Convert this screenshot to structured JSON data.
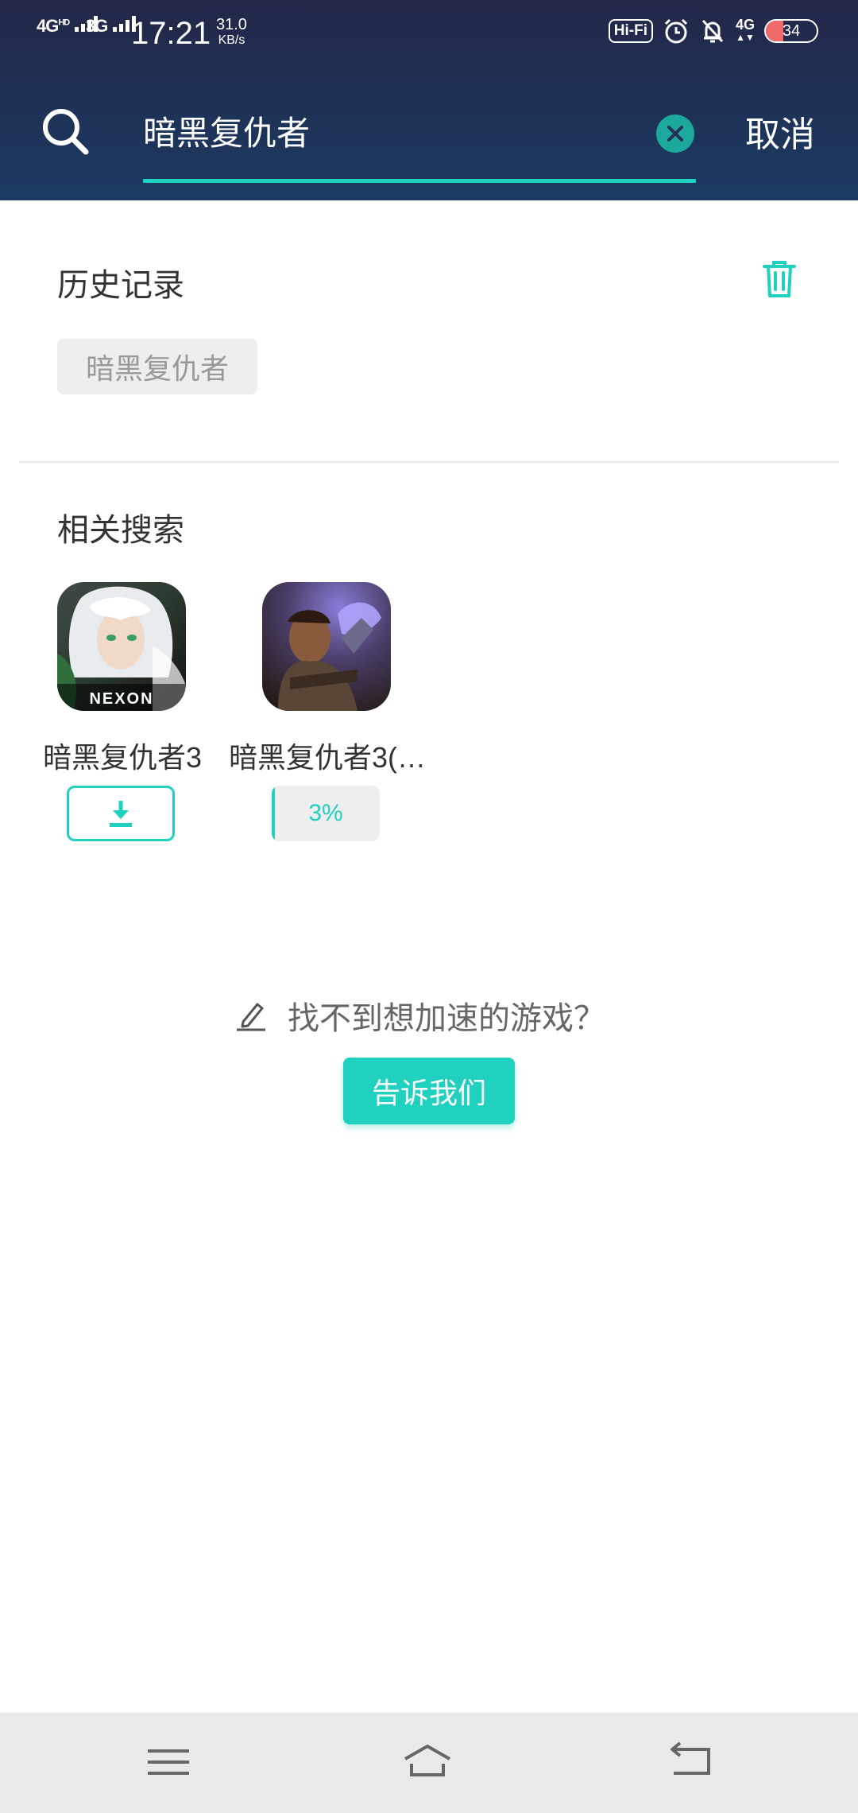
{
  "status_bar": {
    "signal1": "4G",
    "signal1_sup": "HD",
    "signal2": "3G",
    "time": "17:21",
    "speed_value": "31.0",
    "speed_unit": "KB/s",
    "hifi": "Hi-Fi",
    "network": "4G",
    "battery": "34",
    "battery_level": 0.34
  },
  "search": {
    "query": "暗黑复仇者",
    "cancel_label": "取消"
  },
  "history": {
    "title": "历史记录",
    "items": [
      "暗黑复仇者"
    ]
  },
  "related": {
    "title": "相关搜索",
    "games": [
      {
        "name": "暗黑复仇者3",
        "logo_text": "NEXON",
        "state": "download"
      },
      {
        "name": "暗黑复仇者3(…",
        "state": "downloading",
        "progress_label": "3%",
        "progress": 0.03
      }
    ]
  },
  "feedback": {
    "prompt": "找不到想加速的游戏？",
    "button_label": "告诉我们"
  },
  "colors": {
    "accent": "#1fd1be",
    "header_top": "#232748",
    "header_bottom": "#1b3a62"
  }
}
